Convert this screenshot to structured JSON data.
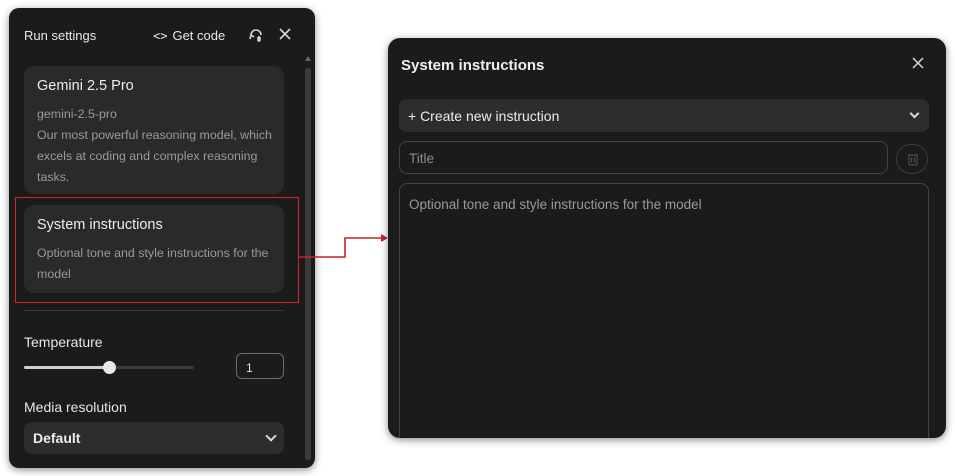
{
  "run_settings": {
    "header": "Run settings",
    "get_code_icon": "<>",
    "get_code_label": "Get code",
    "model_card": {
      "title": "Gemini 2.5 Pro",
      "id": "gemini-2.5-pro",
      "description": "Our most powerful reasoning model, which excels at coding and complex reasoning tasks."
    },
    "system_card": {
      "title": "System instructions",
      "description": "Optional tone and style instructions for the model"
    },
    "temperature": {
      "label": "Temperature",
      "value": "1",
      "slider_fraction": 0.5
    },
    "media_resolution": {
      "label": "Media resolution",
      "selected": "Default"
    },
    "icons": [
      "code-icon",
      "compare-icon",
      "close-icon",
      "chevron-down-icon"
    ]
  },
  "system_instructions_panel": {
    "title": "System instructions",
    "create_label": "+ Create new instruction",
    "title_placeholder": "Title",
    "body_placeholder": "Optional tone and style instructions for the model",
    "icons": [
      "close-icon",
      "chevron-down-icon",
      "trash-icon"
    ]
  },
  "colors": {
    "panel_bg": "#1b1b1b",
    "card_bg": "#2a2a2a",
    "highlight": "#d3262b",
    "arrow": "#c8202a"
  }
}
